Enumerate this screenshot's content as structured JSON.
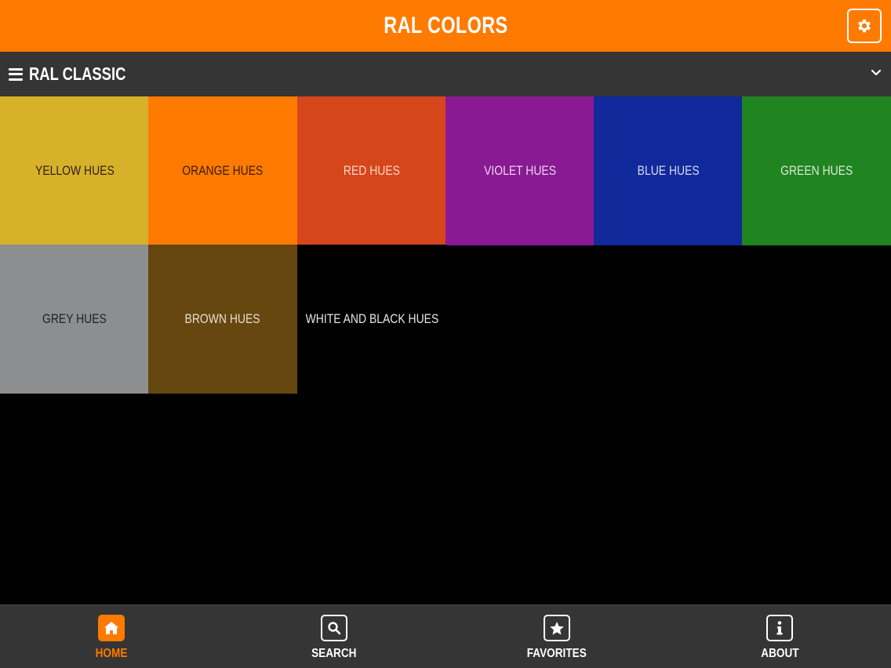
{
  "header": {
    "title": "RAL COLORS",
    "settings_icon": "gear-icon"
  },
  "category_bar": {
    "label": "RAL CLASSIC",
    "menu_icon": "hamburger-icon",
    "dropdown_icon": "chevron-down-icon"
  },
  "tiles": [
    {
      "label": "YELLOW HUES",
      "bg": "#d7b12a",
      "fg": "#2b2410"
    },
    {
      "label": "ORANGE HUES",
      "bg": "#ff7a00",
      "fg": "#3a1c00"
    },
    {
      "label": "RED HUES",
      "bg": "#d6461b",
      "fg": "#f6d6cc"
    },
    {
      "label": "VIOLET HUES",
      "bg": "#8a1a94",
      "fg": "#ecd4ef"
    },
    {
      "label": "BLUE HUES",
      "bg": "#11299a",
      "fg": "#d7dcf2"
    },
    {
      "label": "GREEN HUES",
      "bg": "#208420",
      "fg": "#d8ecd8"
    },
    {
      "label": "GREY HUES",
      "bg": "#8d8e90",
      "fg": "#1f1f1f"
    },
    {
      "label": "BROWN HUES",
      "bg": "#664710",
      "fg": "#e9dfcf"
    },
    {
      "label": "WHITE AND BLACK HUES",
      "bg": "#000000",
      "fg": "#e6e6e6"
    }
  ],
  "bottom_nav": [
    {
      "label": "HOME",
      "icon": "home-icon",
      "active": true
    },
    {
      "label": "SEARCH",
      "icon": "search-icon",
      "active": false
    },
    {
      "label": "FAVORITES",
      "icon": "star-icon",
      "active": false
    },
    {
      "label": "ABOUT",
      "icon": "info-icon",
      "active": false
    }
  ],
  "colors": {
    "accent": "#ff7a00",
    "bar": "#353535",
    "background": "#000000"
  }
}
